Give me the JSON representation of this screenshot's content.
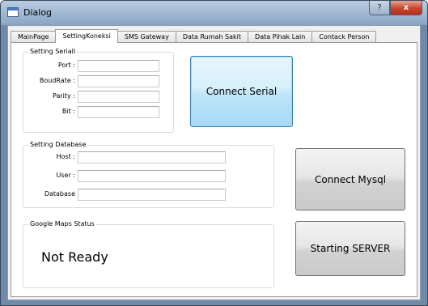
{
  "window": {
    "title": "Dialog",
    "help_label": "?",
    "close_label": "x"
  },
  "tabs": [
    {
      "label": "MainPage"
    },
    {
      "label": "SettingKoneksi"
    },
    {
      "label": "SMS Gateway"
    },
    {
      "label": "Data Rumah Sakit"
    },
    {
      "label": "Data Pihak Lain"
    },
    {
      "label": "Contack Person"
    }
  ],
  "active_tab": "SettingKoneksi",
  "serial": {
    "title": "Setting Seriall",
    "port_label": "Port :",
    "port_value": "",
    "baud_label": "BoudRate :",
    "baud_value": "",
    "parity_label": "Parity :",
    "parity_value": "",
    "bit_label": "Bit :",
    "bit_value": ""
  },
  "connect_serial_label": "Connect Serial",
  "database": {
    "title": "Setting Database",
    "host_label": "Host :",
    "host_value": "",
    "user_label": "User :",
    "user_value": "",
    "database_label": "Database",
    "database_value": ""
  },
  "connect_mysql_label": "Connect Mysql",
  "maps": {
    "title": "Google Maps Status",
    "status": "Not Ready"
  },
  "start_server_label": "Starting SERVER"
}
